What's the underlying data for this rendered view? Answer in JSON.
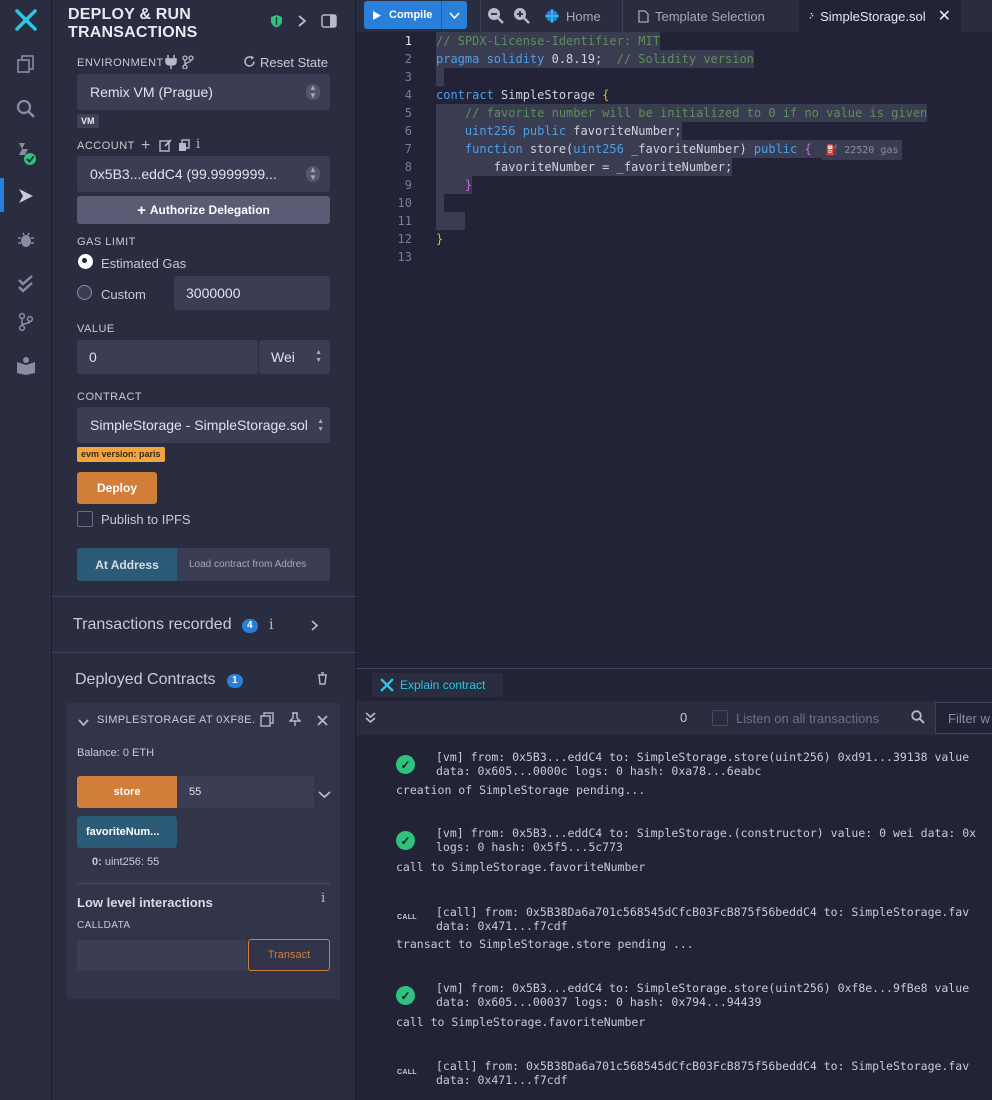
{
  "iconbar": {
    "icons": [
      "remix-logo-icon",
      "file-explorer-icon",
      "search-icon",
      "solidity-compiler-icon",
      "deploy-run-icon",
      "debugger-icon",
      "solidity-unit-testing-icon",
      "git-icon",
      "learneth-icon"
    ]
  },
  "panel": {
    "title": "DEPLOY & RUN TRANSACTIONS",
    "environment": {
      "label": "ENVIRONMENT",
      "reset": "Reset State",
      "value": "Remix VM (Prague)",
      "badge": "VM"
    },
    "account": {
      "label": "ACCOUNT",
      "value": "0x5B3...eddC4 (99.9999999...",
      "authorize": "Authorize Delegation"
    },
    "gas": {
      "label": "GAS LIMIT",
      "estimated": "Estimated Gas",
      "custom": "Custom",
      "custom_value": "3000000"
    },
    "value": {
      "label": "VALUE",
      "amount": "0",
      "unit": "Wei"
    },
    "contract": {
      "label": "CONTRACT",
      "value": "SimpleStorage - SimpleStorage.sol",
      "evm": "evm version: paris"
    },
    "deploy": "Deploy",
    "publish": "Publish to IPFS",
    "at_address": "At Address",
    "load_placeholder": "Load contract from Addres",
    "recorded": {
      "title": "Transactions recorded",
      "count": "4"
    },
    "deployed": {
      "title": "Deployed Contracts",
      "count": "1",
      "instance": {
        "name": "SIMPLESTORAGE AT 0XF8E.",
        "balance": "Balance: 0 ETH",
        "store_label": "store",
        "store_value": "55",
        "fav_label": "favoriteNum...",
        "fav_result_key": "0:",
        "fav_result": " uint256: 55",
        "low_level": "Low level interactions",
        "calldata": "CALLDATA",
        "transact": "Transact"
      }
    }
  },
  "editor": {
    "compile": "Compile",
    "tabs": {
      "home": "Home",
      "template": "Template Selection",
      "file": "SimpleStorage.sol"
    },
    "lines": [
      "1",
      "2",
      "3",
      "4",
      "5",
      "6",
      "7",
      "8",
      "9",
      "10",
      "11",
      "12",
      "13"
    ],
    "code": {
      "l1": "// SPDX-License-Identifier: MIT",
      "l2a": "pragma solidity",
      "l2b": " 0.8.19;",
      "l2c": "  // Solidity version",
      "l4a": "contract",
      "l4b": " SimpleStorage ",
      "l4c": "{",
      "l5": "    // favorite number will be initialized to 0 if no value is given",
      "l6a": "    uint256 public",
      "l6b": " favoriteNumber;",
      "l7a": "    function",
      "l7b": " store(",
      "l7c": "uint256",
      "l7d": " _favoriteNumber) ",
      "l7e": "public",
      "l7f": " {",
      "gas": "22520 gas",
      "l8": "        favoriteNumber = _favoriteNumber;",
      "l9": "    }",
      "l11": "    ",
      "l12": "}"
    }
  },
  "terminal": {
    "explain": "Explain contract",
    "pending_count": "0",
    "listen": "Listen on all transactions",
    "filter_placeholder": "Filter w",
    "entries": [
      {
        "l1": "[vm]  from: 0x5B3...eddC4 to: SimpleStorage.store(uint256) 0xd91...39138 value",
        "l2": "data: 0x605...0000c logs: 0 hash: 0xa78...6eabc",
        "msg": "creation of SimpleStorage pending..."
      },
      {
        "l1": "[vm]  from: 0x5B3...eddC4 to: SimpleStorage.(constructor) value: 0 wei data: 0x",
        "l2": "logs: 0 hash: 0x5f5...5c773",
        "msg": "call to SimpleStorage.favoriteNumber"
      },
      {
        "l1": "[call]  from: 0x5B38Da6a701c568545dCfcB03FcB875f56beddC4 to: SimpleStorage.fav",
        "l2": "data: 0x471...f7cdf",
        "msg": "transact to SimpleStorage.store pending ..."
      },
      {
        "l1": "[vm]  from: 0x5B3...eddC4 to: SimpleStorage.store(uint256) 0xf8e...9fBe8 value",
        "l2": "data: 0x605...00037 logs: 0 hash: 0x794...94439",
        "msg": "call to SimpleStorage.favoriteNumber"
      },
      {
        "l1": "[call]  from: 0x5B38Da6a701c568545dCfcB03FcB875f56beddC4 to: SimpleStorage.fav",
        "l2": "data: 0x471...f7cdf"
      }
    ],
    "call_tag": "CALL"
  },
  "colors": {
    "accent": "#2a7fd8",
    "deploy": "#d27d38",
    "ok": "#2ec27e",
    "teal": "#2cc6e6"
  }
}
